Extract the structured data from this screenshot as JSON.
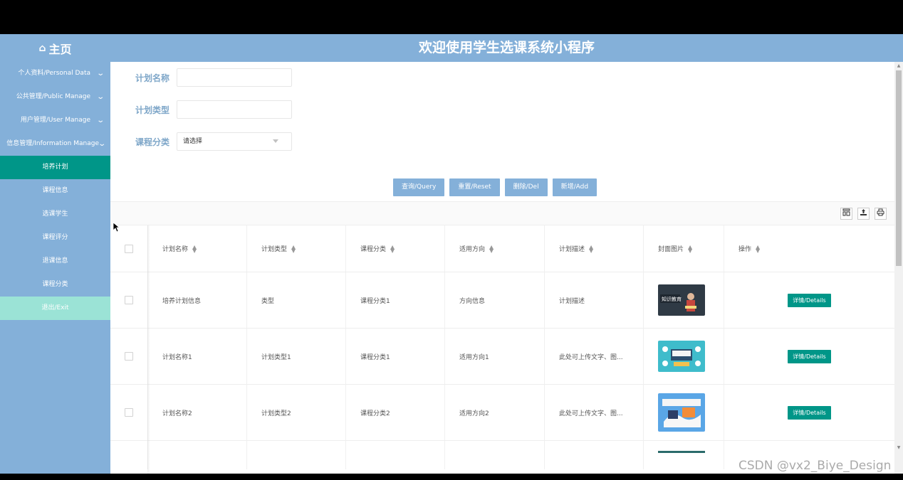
{
  "header": {
    "home_icon": "home-icon",
    "home_label": "主页",
    "title": "欢迎使用学生选课系统小程序"
  },
  "sidebar": {
    "items": [
      {
        "label": "个人资料/Personal Data",
        "type": "group"
      },
      {
        "label": "公共管理/Public Manage",
        "type": "group"
      },
      {
        "label": "用户管理/User Manage",
        "type": "group"
      },
      {
        "label": "信息管理/Information Manage",
        "type": "group"
      },
      {
        "label": "培养计划",
        "type": "active"
      },
      {
        "label": "课程信息",
        "type": "sub"
      },
      {
        "label": "选课学生",
        "type": "sub"
      },
      {
        "label": "课程评分",
        "type": "sub"
      },
      {
        "label": "退课信息",
        "type": "sub"
      },
      {
        "label": "课程分类",
        "type": "sub"
      },
      {
        "label": "退出/Exit",
        "type": "exit"
      }
    ]
  },
  "search": {
    "plan_name_label": "计划名称",
    "plan_name_value": "",
    "plan_type_label": "计划类型",
    "plan_type_value": "",
    "category_label": "课程分类",
    "category_selected": "请选择"
  },
  "buttons": {
    "query": "查询/Query",
    "reset": "重置/Reset",
    "delete": "删除/Del",
    "add": "新增/Add"
  },
  "toolbar": {
    "icons": [
      "columns-icon",
      "export-icon",
      "print-icon"
    ]
  },
  "table": {
    "columns": [
      "计划名称",
      "计划类型",
      "课程分类",
      "适用方向",
      "计划描述",
      "封面图片",
      "操作"
    ],
    "rows": [
      {
        "name": "培养计划信息",
        "type": "类型",
        "category": "课程分类1",
        "direction": "方向信息",
        "desc": "计划描述",
        "cover": "知识教育",
        "action": "详情/Details"
      },
      {
        "name": "计划名称1",
        "type": "计划类型1",
        "category": "课程分类1",
        "direction": "适用方向1",
        "desc": "此处可上传文字、图...",
        "cover": "",
        "action": "详情/Details"
      },
      {
        "name": "计划名称2",
        "type": "计划类型2",
        "category": "课程分类2",
        "direction": "适用方向2",
        "desc": "此处可上传文字、图...",
        "cover": "",
        "action": "详情/Details"
      }
    ]
  },
  "watermark": "CSDN @vx2_Biye_Design",
  "colors": {
    "primary": "#84b0d9",
    "accent": "#009688",
    "exit": "#9be3d6",
    "label": "#7fa7c9"
  }
}
